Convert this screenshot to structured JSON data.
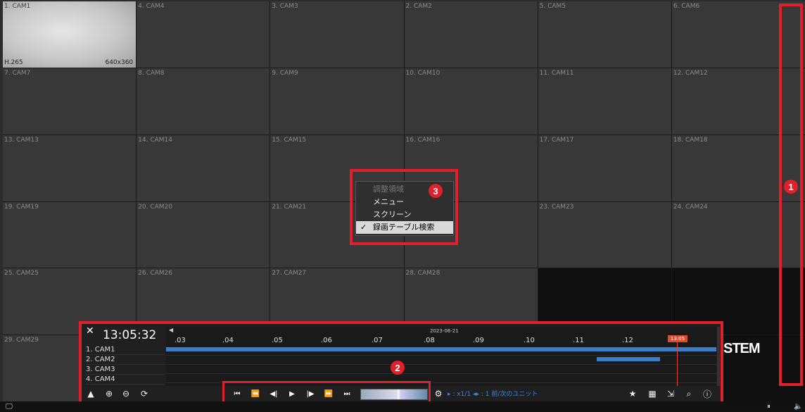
{
  "cameras": [
    {
      "label": "1. CAM1",
      "codec": "H.265",
      "resolution": "640x360"
    },
    {
      "label": "4. CAM4"
    },
    {
      "label": "3. CAM3"
    },
    {
      "label": "2. CAM2"
    },
    {
      "label": "5. CAM5"
    },
    {
      "label": "6. CAM6"
    },
    {
      "label": "7. CAM7"
    },
    {
      "label": "8. CAM8"
    },
    {
      "label": "9. CAM9"
    },
    {
      "label": "10. CAM10"
    },
    {
      "label": "11. CAM11"
    },
    {
      "label": "12. CAM12"
    },
    {
      "label": "13. CAM13"
    },
    {
      "label": "14. CAM14"
    },
    {
      "label": "15. CAM15"
    },
    {
      "label": "16. CAM16"
    },
    {
      "label": "17. CAM17"
    },
    {
      "label": "18. CAM18"
    },
    {
      "label": "19. CAM19"
    },
    {
      "label": "20. CAM20"
    },
    {
      "label": "21. CAM21"
    },
    {
      "label": ""
    },
    {
      "label": "23. CAM23"
    },
    {
      "label": "24. CAM24"
    },
    {
      "label": "25. CAM25"
    },
    {
      "label": "26. CAM26"
    },
    {
      "label": "27. CAM27"
    },
    {
      "label": "28. CAM28"
    },
    {
      "label": ""
    },
    {
      "label": ""
    },
    {
      "label": "29. CAM29"
    },
    {
      "label": ""
    },
    {
      "label": ""
    },
    {
      "label": ""
    },
    {
      "label": ""
    },
    {
      "label": ""
    }
  ],
  "brand_text": "STEM",
  "context_menu": {
    "header": "調整領域",
    "items": [
      "メニュー",
      "スクリーン",
      "録画テーブル検索"
    ],
    "checked_index": 2
  },
  "badges": [
    "1",
    "2",
    "3"
  ],
  "playback": {
    "time": "13:05:32",
    "date": "2023-06-21",
    "channels": [
      "1. CAM1",
      "2. CAM2",
      "3. CAM3",
      "4. CAM4"
    ],
    "ticks": [
      ".03",
      ".04",
      ".05",
      ".06",
      ".07",
      ".08",
      ".09",
      ".10",
      ".11",
      ".12"
    ],
    "cursor_time": "13:05",
    "speed_label": "x1/1",
    "unit_label": "1 前/次のユニット",
    "accent_color": "#3b7dc8",
    "cursor_color": "#e04a2a",
    "recordings": [
      {
        "channel": 0,
        "from": ".03",
        "to": ".13:05"
      },
      {
        "channel": 1,
        "from": ".11",
        "to": ".12"
      }
    ]
  },
  "icons": {
    "close": "close-icon",
    "collapse": "triangle-up-icon",
    "zoom_in": "zoom-in-icon",
    "zoom_out": "zoom-out-icon",
    "refresh": "refresh-icon",
    "settings": "gear-icon",
    "bookmark": "star-icon",
    "calendar": "calendar-icon",
    "export": "export-icon",
    "search": "search-doc-icon",
    "info": "info-icon"
  }
}
